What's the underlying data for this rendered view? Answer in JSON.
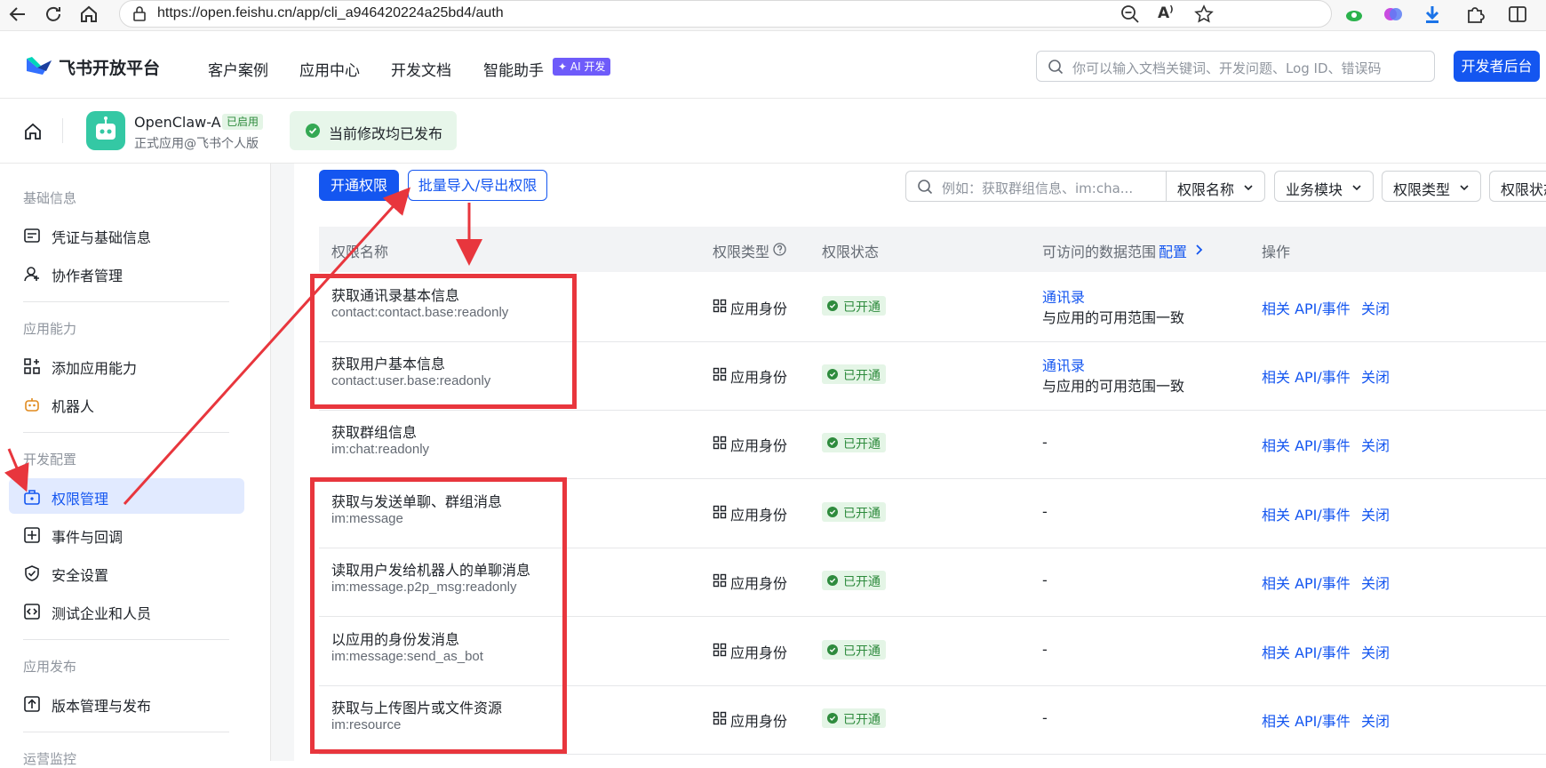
{
  "browser": {
    "url": "https://open.feishu.cn/app/cli_a946420224a25bd4/auth",
    "icons": [
      "back-arrow-icon",
      "refresh-icon",
      "home-icon",
      "site-info-icon",
      "zoom-out-icon",
      "read-aloud-icon",
      "favorite-star-icon",
      "cloud-extension-icon",
      "brain-extension-icon",
      "download-icon",
      "extensions-icon",
      "split-screen-icon"
    ]
  },
  "header": {
    "brand": "飞书开放平台",
    "nav": [
      "客户案例",
      "应用中心",
      "开发文档",
      "智能助手"
    ],
    "ai_badge": "✦ AI 开发",
    "search_placeholder": "你可以输入文档关键词、开发问题、Log ID、错误码",
    "dev_button": "开发者后台"
  },
  "appbar": {
    "app_name": "OpenClaw-AI",
    "app_tag": "已启用",
    "app_sub": "正式应用@飞书个人版",
    "publish_status": "当前修改均已发布"
  },
  "sidebar": {
    "sections": [
      {
        "title": "基础信息",
        "items": [
          {
            "label": "凭证与基础信息",
            "icon": "credential-icon"
          },
          {
            "label": "协作者管理",
            "icon": "collaborator-icon"
          }
        ]
      },
      {
        "title": "应用能力",
        "items": [
          {
            "label": "添加应用能力",
            "icon": "add-capability-icon"
          },
          {
            "label": "机器人",
            "icon": "robot-icon"
          }
        ]
      },
      {
        "title": "开发配置",
        "items": [
          {
            "label": "权限管理",
            "icon": "permission-icon",
            "active": true
          },
          {
            "label": "事件与回调",
            "icon": "event-icon"
          },
          {
            "label": "安全设置",
            "icon": "shield-icon"
          },
          {
            "label": "测试企业和人员",
            "icon": "code-icon"
          }
        ]
      },
      {
        "title": "应用发布",
        "items": [
          {
            "label": "版本管理与发布",
            "icon": "upload-icon"
          }
        ]
      },
      {
        "title": "运营监控",
        "items": []
      }
    ]
  },
  "toolbar": {
    "open_button": "开通权限",
    "batch_button": "批量导入/导出权限",
    "search_placeholder": "例如：获取群组信息、im:cha...",
    "filters": [
      "权限名称",
      "业务模块",
      "权限类型",
      "权限状态"
    ]
  },
  "table": {
    "headers": {
      "name": "权限名称",
      "type": "权限类型",
      "status": "权限状态",
      "scope": "可访问的数据范围",
      "scope_link": "配置",
      "actions": "操作"
    },
    "rows": [
      {
        "name": "获取通讯录基本信息",
        "code": "contact:contact.base:readonly",
        "type": "应用身份",
        "status": "已开通",
        "scope_link": "通讯录",
        "scope_desc": "与应用的可用范围一致"
      },
      {
        "name": "获取用户基本信息",
        "code": "contact:user.base:readonly",
        "type": "应用身份",
        "status": "已开通",
        "scope_link": "通讯录",
        "scope_desc": "与应用的可用范围一致"
      },
      {
        "name": "获取群组信息",
        "code": "im:chat:readonly",
        "type": "应用身份",
        "status": "已开通",
        "scope_dash": "-"
      },
      {
        "name": "获取与发送单聊、群组消息",
        "code": "im:message",
        "type": "应用身份",
        "status": "已开通",
        "scope_dash": "-"
      },
      {
        "name": "读取用户发给机器人的单聊消息",
        "code": "im:message.p2p_msg:readonly",
        "type": "应用身份",
        "status": "已开通",
        "scope_dash": "-"
      },
      {
        "name": "以应用的身份发消息",
        "code": "im:message:send_as_bot",
        "type": "应用身份",
        "status": "已开通",
        "scope_dash": "-"
      },
      {
        "name": "获取与上传图片或文件资源",
        "code": "im:resource",
        "type": "应用身份",
        "status": "已开通",
        "scope_dash": "-"
      }
    ],
    "api_link": "相关 API/事件",
    "close_link": "关闭"
  },
  "colors": {
    "primary": "#1456f0",
    "annotation": "#e8363d",
    "success": "#2e8b3d"
  }
}
